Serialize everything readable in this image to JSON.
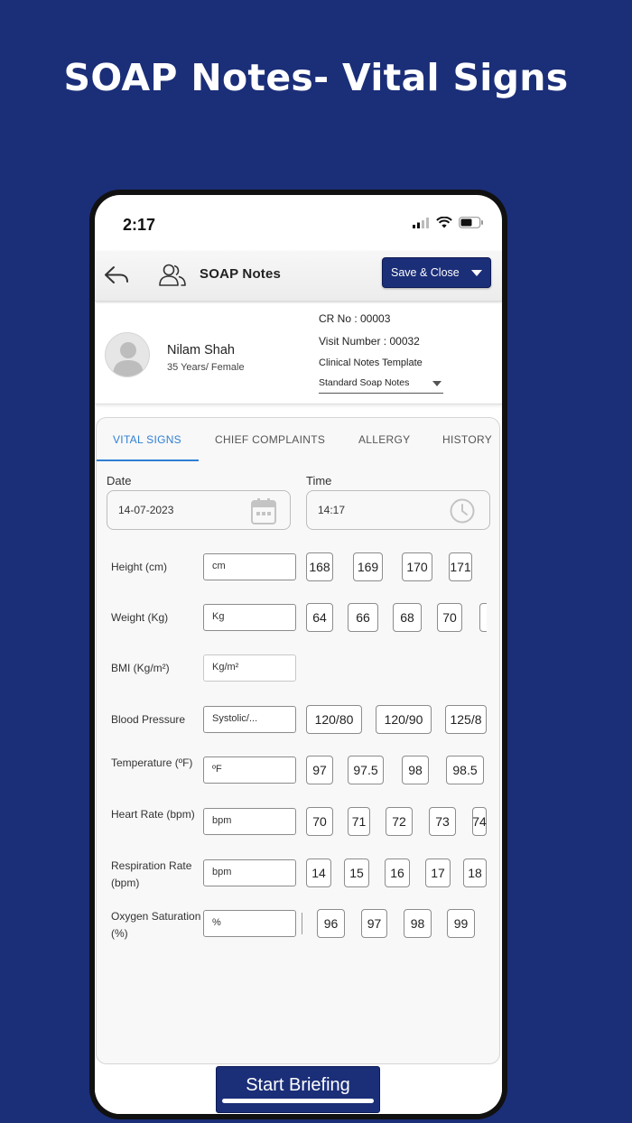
{
  "headline": "SOAP Notes- Vital Signs",
  "status": {
    "time": "2:17"
  },
  "app_bar": {
    "title": "SOAP Notes",
    "save_label": "Save & Close"
  },
  "patient": {
    "name": "Nilam Shah",
    "info": "35 Years/ Female",
    "cr_no": "CR No : 00003",
    "visit_number": "Visit Number : 00032",
    "template_label": "Clinical Notes Template",
    "template_value": "Standard Soap Notes"
  },
  "tabs": [
    {
      "label": "VITAL SIGNS",
      "active": true
    },
    {
      "label": "CHIEF COMPLAINTS",
      "active": false
    },
    {
      "label": "ALLERGY",
      "active": false
    },
    {
      "label": "HISTORY",
      "active": false
    }
  ],
  "date_field": {
    "label": "Date",
    "value": "14-07-2023"
  },
  "time_field": {
    "label": "Time",
    "value": "14:17"
  },
  "vitals": [
    {
      "label": "Height (cm)",
      "placeholder": "cm",
      "chips": [
        "168",
        "169",
        "170",
        "171"
      ]
    },
    {
      "label": "Weight (Kg)",
      "placeholder": "Kg",
      "chips": [
        "64",
        "66",
        "68",
        "70",
        ""
      ]
    },
    {
      "label": "BMI (Kg/m²)",
      "placeholder": "Kg/m²",
      "chips": []
    },
    {
      "label": "Blood Pressure",
      "placeholder": "Systolic/...",
      "chips": [
        "120/80",
        "120/90",
        "125/8"
      ]
    },
    {
      "label": "Temperature (ºF)",
      "placeholder": "ºF",
      "chips": [
        "97",
        "97.5",
        "98",
        "98.5"
      ]
    },
    {
      "label": "Heart Rate (bpm)",
      "placeholder": "bpm",
      "chips": [
        "70",
        "71",
        "72",
        "73",
        "74"
      ]
    },
    {
      "label": "Respiration Rate (bpm)",
      "placeholder": "bpm",
      "chips": [
        "14",
        "15",
        "16",
        "17",
        "18"
      ]
    },
    {
      "label": "Oxygen Saturation (%)",
      "placeholder": "%",
      "chips": [
        "96",
        "97",
        "98",
        "99"
      ]
    }
  ],
  "start_button": "Start Briefing",
  "colors": {
    "brand": "#1b2e78",
    "tab_active": "#2f7fd4"
  }
}
